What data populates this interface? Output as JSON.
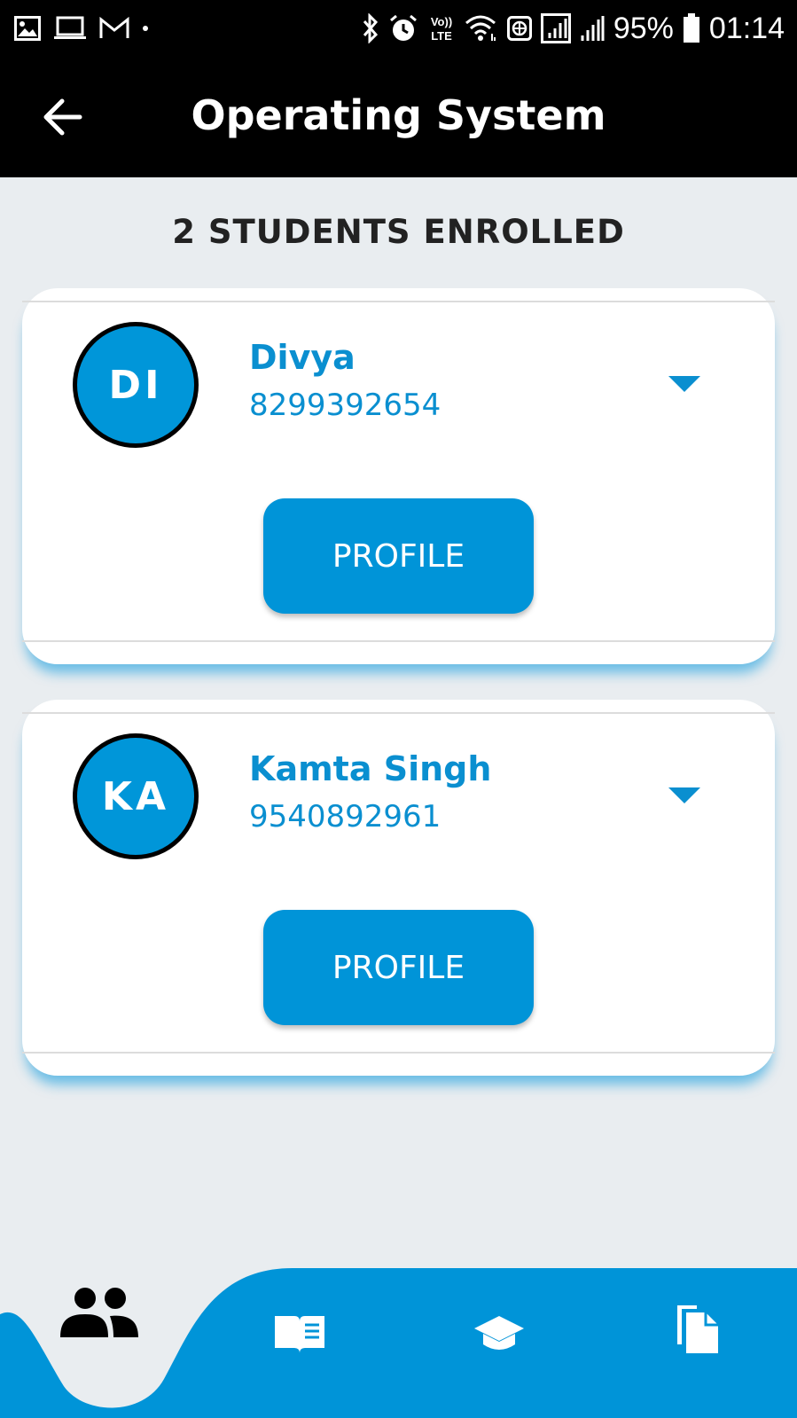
{
  "status_bar": {
    "battery": "95%",
    "time": "01:14",
    "left_icons": [
      "gallery-icon",
      "laptop-icon",
      "gmail-icon",
      "dot-icon"
    ],
    "right_icons": [
      "bluetooth-icon",
      "alarm-icon",
      "volte-icon",
      "wifi-icon",
      "vpn-icon",
      "signal-icon",
      "signal-icon",
      "battery-icon"
    ]
  },
  "app_bar": {
    "title": "Operating System",
    "back_icon": "arrow-left-icon"
  },
  "heading": "2 STUDENTS ENROLLED",
  "students": [
    {
      "initials": "DI",
      "name": "Divya",
      "phone": "8299392654",
      "button_label": "PROFILE"
    },
    {
      "initials": "KA",
      "name": "Kamta Singh",
      "phone": "9540892961",
      "button_label": "PROFILE"
    }
  ],
  "bottom_nav": {
    "items": [
      "students-icon",
      "book-icon",
      "graduation-cap-icon",
      "documents-icon"
    ],
    "active": "students-icon"
  },
  "colors": {
    "primary": "#0094d8",
    "text_blue": "#0a8fd0",
    "background": "#e9edf0",
    "bar": "#000000"
  }
}
